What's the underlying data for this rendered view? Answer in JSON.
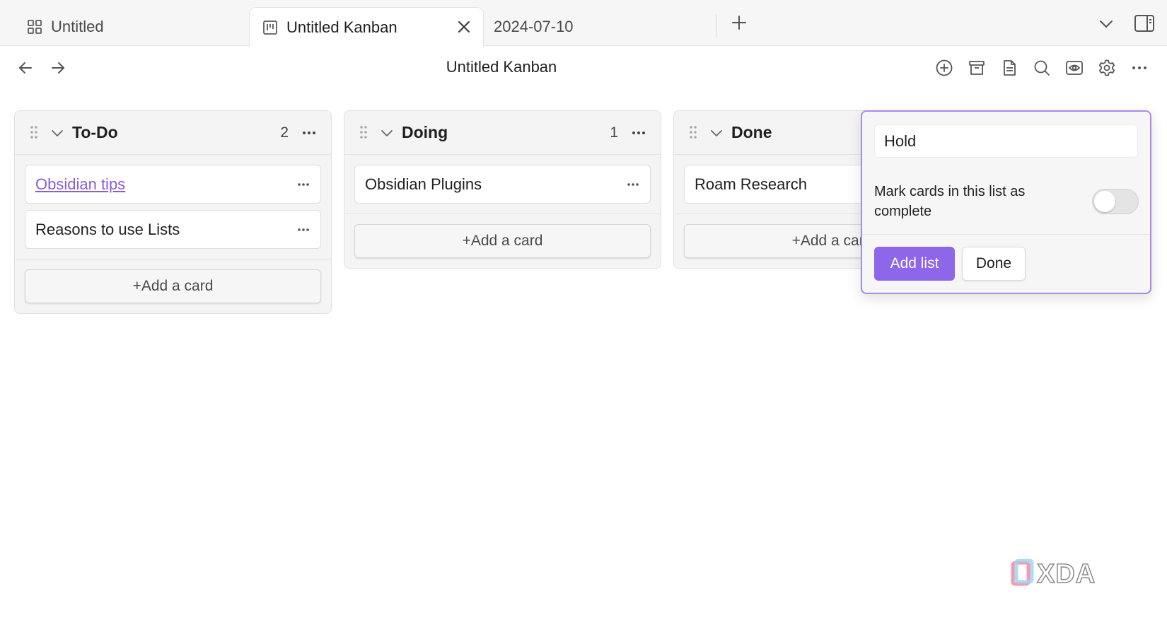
{
  "tabs": [
    {
      "label": "Untitled",
      "icon": "grid-icon"
    },
    {
      "label": "Untitled Kanban",
      "icon": "kanban-board-icon",
      "active": true
    },
    {
      "label": "2024-07-10"
    }
  ],
  "header": {
    "title": "Untitled Kanban",
    "actions": [
      "add-circle-icon",
      "archive-icon",
      "document-icon",
      "search-icon",
      "view-icon",
      "settings-icon",
      "more-icon"
    ]
  },
  "lanes": [
    {
      "title": "To-Do",
      "count": "2",
      "cards": [
        {
          "text": "Obsidian tips",
          "is_link": true
        },
        {
          "text": "Reasons to use Lists"
        }
      ],
      "add_card_label": "+Add a card"
    },
    {
      "title": "Doing",
      "count": "1",
      "cards": [
        {
          "text": "Obsidian Plugins"
        }
      ],
      "add_card_label": "+Add a card"
    },
    {
      "title": "Done",
      "cards": [
        {
          "text": "Roam Research"
        }
      ],
      "add_card_label": "+Add a card"
    }
  ],
  "add_list_form": {
    "name_value": "Hold",
    "complete_label": "Mark cards in this list as complete",
    "complete_toggle_on": false,
    "add_button": "Add list",
    "done_button": "Done"
  },
  "watermark": "XDA",
  "colors": {
    "accent": "#8d66ea",
    "link": "#8a5cd6",
    "popover_border": "#a98ae8"
  }
}
